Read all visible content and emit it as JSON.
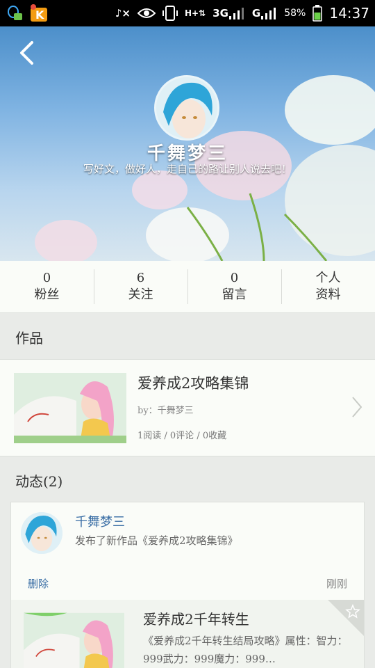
{
  "status_bar": {
    "battery": "58%",
    "time": "14:37",
    "network_1": "3G",
    "network_2": "G"
  },
  "header": {
    "user_name": "千舞梦三",
    "motto": "写好文，做好人，走自己的路让别人说去吧！"
  },
  "stats": [
    {
      "value": "0",
      "label": "粉丝"
    },
    {
      "value": "6",
      "label": "关注"
    },
    {
      "value": "0",
      "label": "留言"
    },
    {
      "value": "个人",
      "label": "资料"
    }
  ],
  "works_section": {
    "title": "作品",
    "item": {
      "title": "爱养成2攻略集锦",
      "author": "by：千舞梦三",
      "stats": "1阅读 / 0评论 / 0收藏"
    }
  },
  "activity_section": {
    "title": "动态(2)",
    "item": {
      "user": "千舞梦三",
      "action": "发布了新作品《爱养成2攻略集锦》",
      "delete_label": "删除",
      "time": "刚刚",
      "work_title": "爱养成2千年转生",
      "work_desc": "《爱养成2千年转生结局攻略》属性：智力：999武力：999魔力：999…"
    }
  }
}
